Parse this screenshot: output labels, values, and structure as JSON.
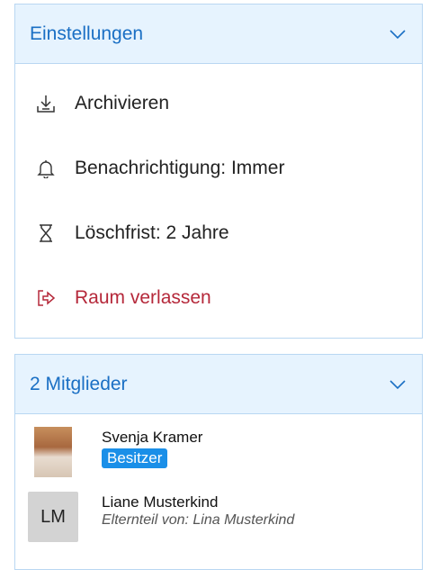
{
  "settings": {
    "title": "Einstellungen",
    "items": [
      {
        "label": "Archivieren",
        "icon": "download-icon"
      },
      {
        "label": "Benachrichtigung: Immer",
        "icon": "bell-icon"
      },
      {
        "label": "Löschfrist: 2 Jahre",
        "icon": "hourglass-icon"
      },
      {
        "label": "Raum verlassen",
        "icon": "exit-icon",
        "color": "#b5283a"
      }
    ]
  },
  "members": {
    "title": "2 Mitglieder",
    "list": [
      {
        "name": "Svenja Kramer",
        "role": "Besitzer"
      },
      {
        "name": "Liane Musterkind",
        "initials": "LM",
        "subtitle": "Elternteil von: Lina Musterkind"
      }
    ]
  },
  "colors": {
    "accent": "#1a6fc4",
    "header_bg": "#e6f3fe",
    "border": "#b9d7f2",
    "danger": "#b5283a",
    "badge": "#1a8fe8"
  }
}
